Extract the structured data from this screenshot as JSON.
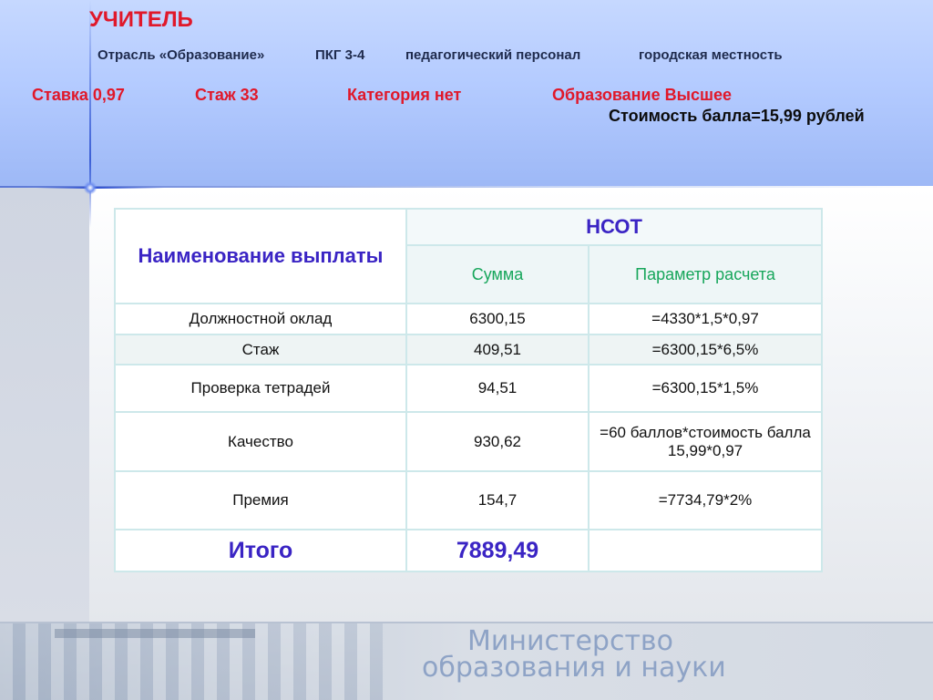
{
  "header": {
    "title": "УЧИТЕЛЬ",
    "sector": "Отрасль «Образование»",
    "pkg": "ПКГ 3-4",
    "personnel": "педагогический персонал",
    "location": "городская местность",
    "rate": "Ставка 0,97",
    "experience": "Стаж 33",
    "category": "Категория нет",
    "education": "Образование Высшее",
    "point_cost": "Стоимость балла=15,99 рублей"
  },
  "table": {
    "col_name_header": "Наименование выплаты",
    "group_header": "НСОТ",
    "col_sum_header": "Сумма",
    "col_param_header": "Параметр расчета",
    "rows": [
      {
        "name": "Должностной оклад",
        "sum": "6300,15",
        "param": "=4330*1,5*0,97"
      },
      {
        "name": "Стаж",
        "sum": "409,51",
        "param": "=6300,15*6,5%"
      },
      {
        "name": "Проверка тетрадей",
        "sum": "94,51",
        "param": "=6300,15*1,5%"
      },
      {
        "name": "Качество",
        "sum": "930,62",
        "param": "=60 баллов*стоимость балла 15,99*0,97"
      },
      {
        "name": "Премия",
        "sum": "154,7",
        "param": "=7734,79*2%"
      }
    ],
    "total_label": "Итого",
    "total_value": "7889,49",
    "total_param": ""
  },
  "footer": {
    "line1": "Министерство",
    "line2": "образования и науки"
  },
  "colors": {
    "accent_red": "#e0182a",
    "accent_blue": "#3a24c4",
    "accent_green": "#17a65b"
  }
}
